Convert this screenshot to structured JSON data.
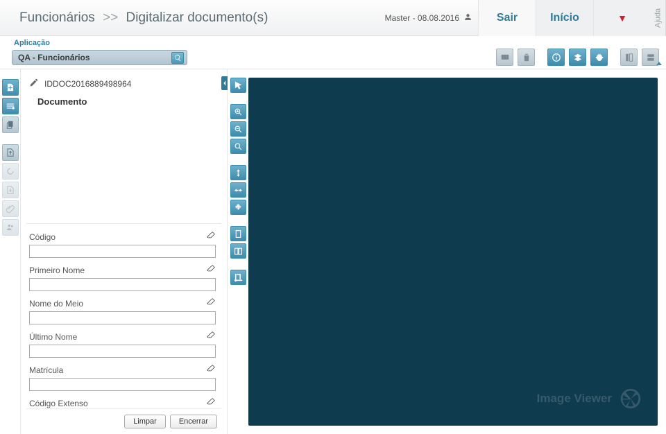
{
  "header": {
    "breadcrumb_module": "Funcionários",
    "breadcrumb_sep": ">>",
    "breadcrumb_action": "Digitalizar documento(s)",
    "user": "Master - 08.08.2016",
    "btn_exit": "Sair",
    "btn_home": "Início",
    "help_label": "Ajuda"
  },
  "app": {
    "label": "Aplicação",
    "selected": "QA - Funcionários"
  },
  "document": {
    "id": "IDDOC2016889498964",
    "tree_root": "Documento"
  },
  "fields": [
    {
      "label": "Código",
      "value": ""
    },
    {
      "label": "Primeiro Nome",
      "value": ""
    },
    {
      "label": "Nome do Meio",
      "value": ""
    },
    {
      "label": "Último Nome",
      "value": ""
    },
    {
      "label": "Matrícula",
      "value": ""
    },
    {
      "label": "Código Extenso",
      "value": ""
    }
  ],
  "buttons": {
    "clear": "Limpar",
    "close": "Encerrar"
  },
  "viewer": {
    "watermark": "Image Viewer"
  }
}
